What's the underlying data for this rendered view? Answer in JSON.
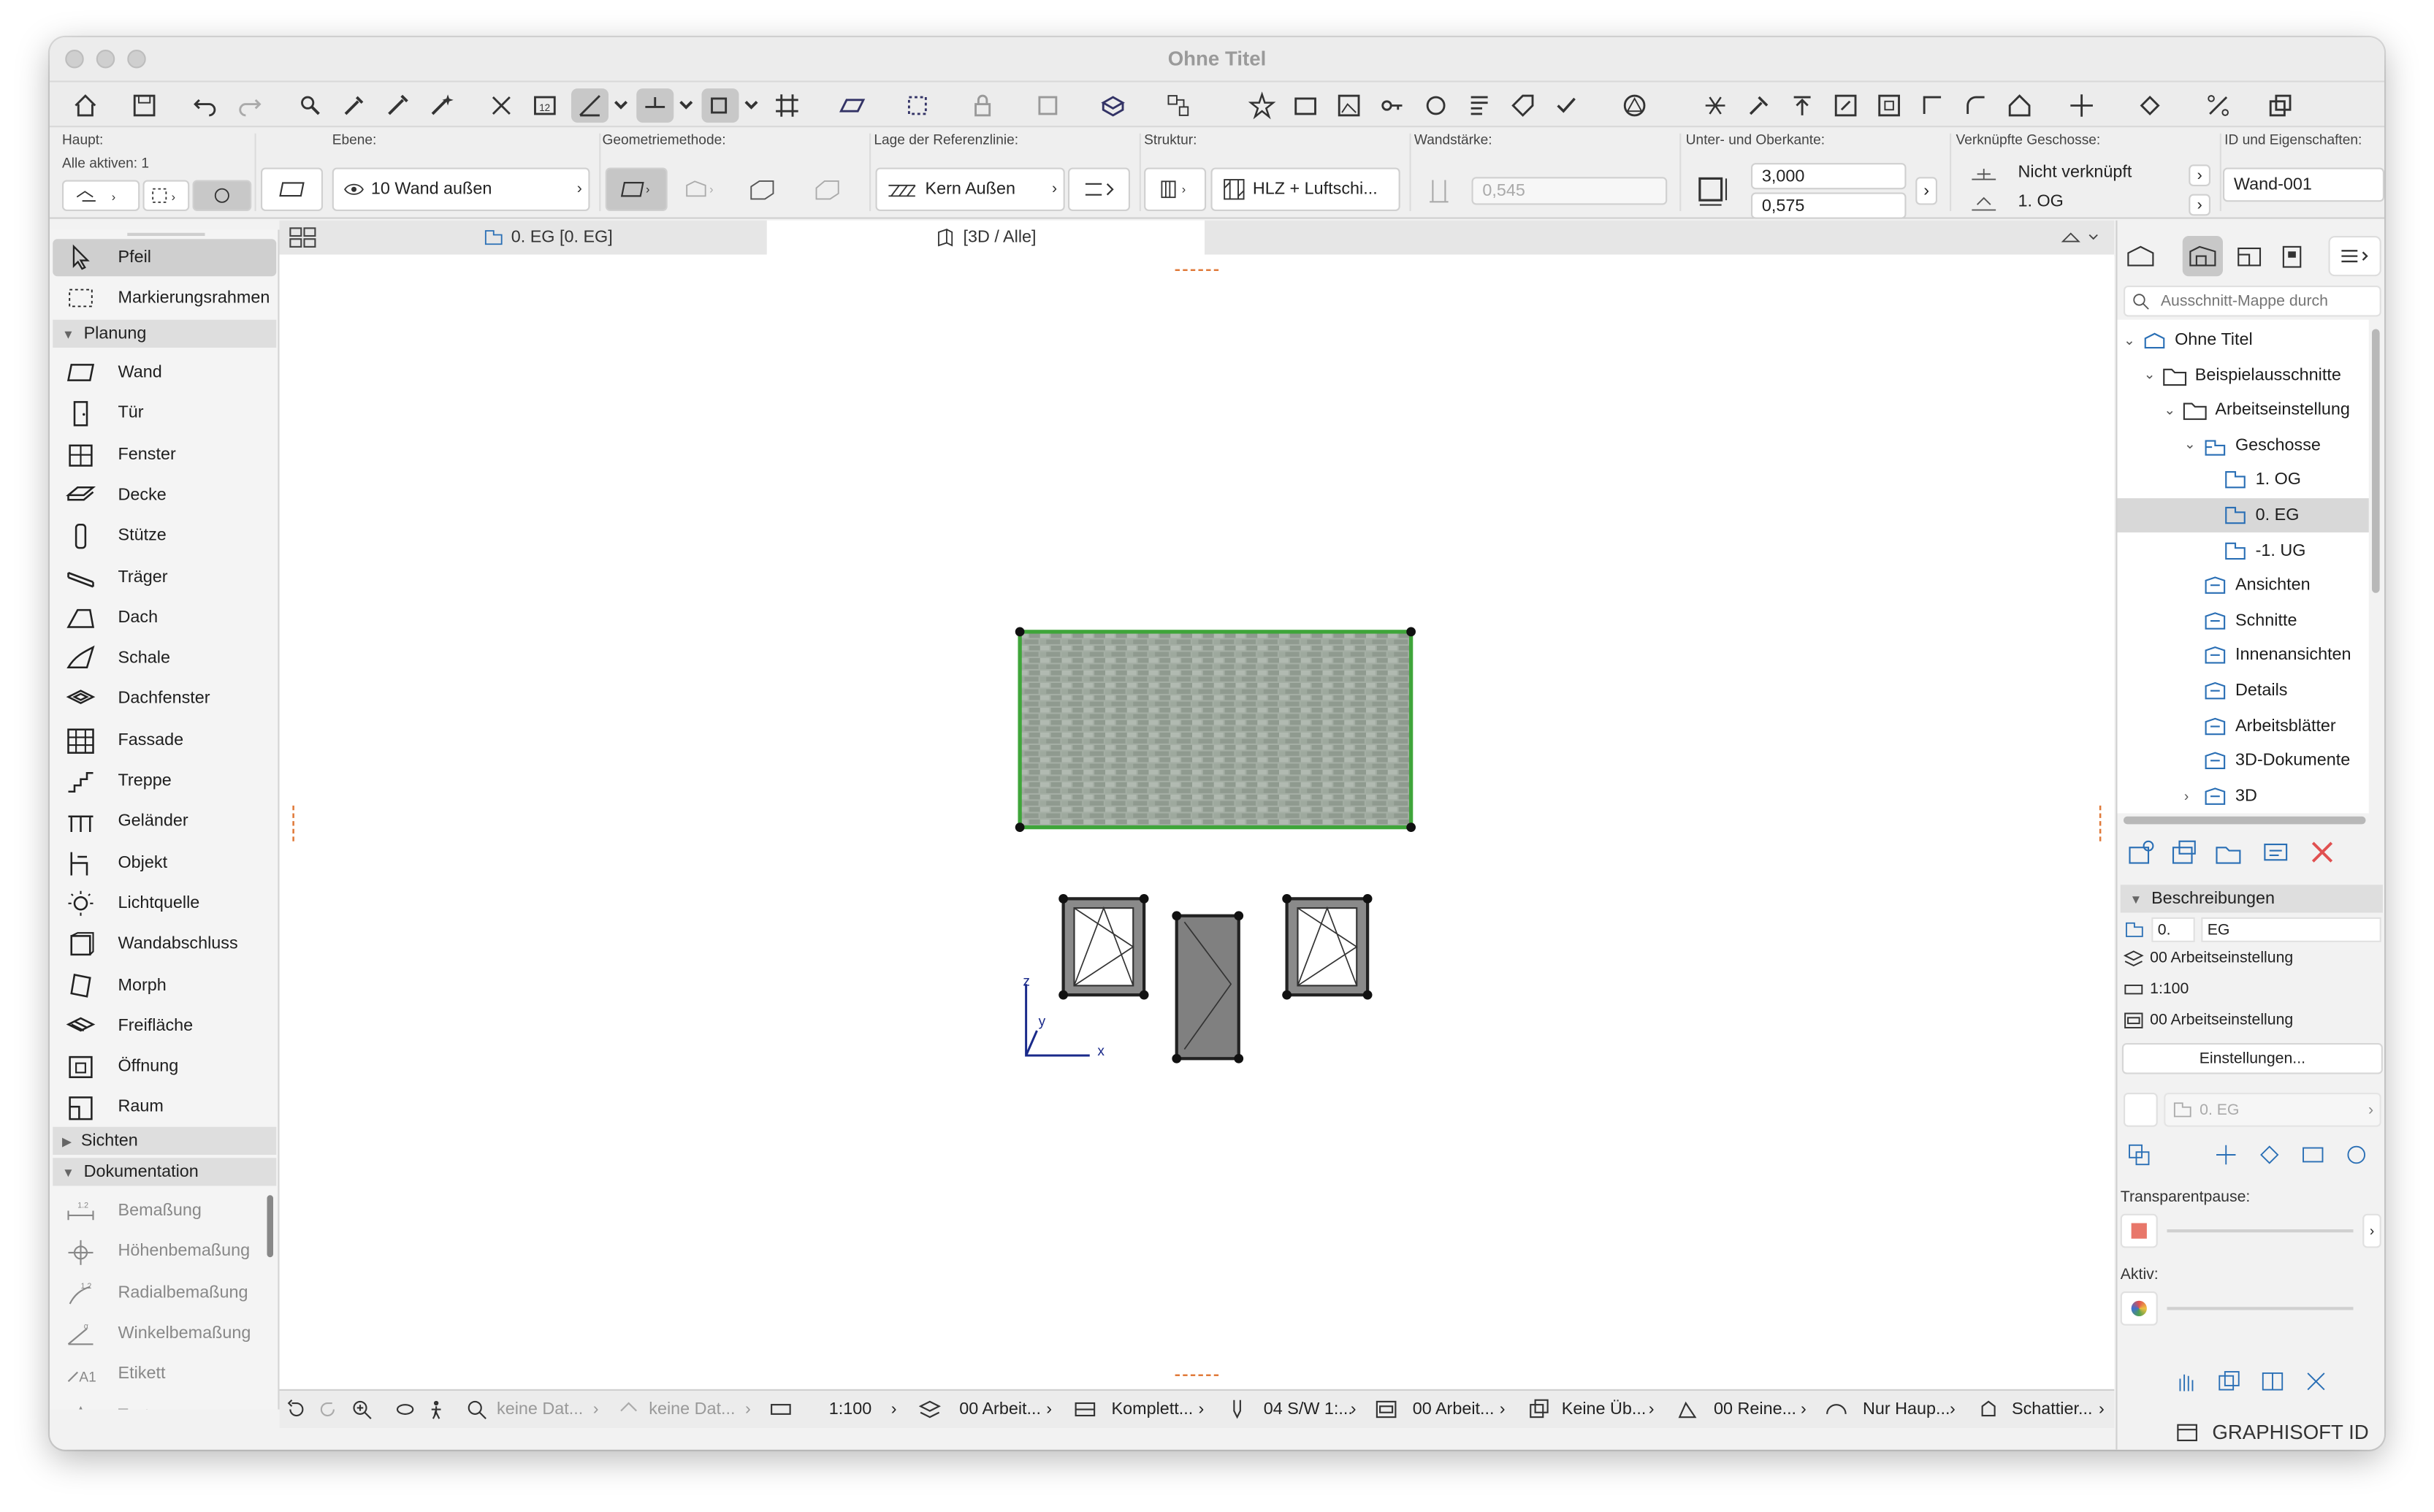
{
  "window": {
    "title": "Ohne Titel"
  },
  "info": {
    "haupt_label": "Haupt:",
    "alle_aktiven": "Alle aktiven: 1",
    "ebene_label": "Ebene:",
    "ebene_value": "10 Wand außen",
    "geometrie_label": "Geometriemethode:",
    "referenz_label": "Lage der Referenzlinie:",
    "referenz_value": "Kern Außen",
    "struktur_label": "Struktur:",
    "struktur_value": "HLZ + Luftschi...",
    "wandstaerke_label": "Wandstärke:",
    "wandstaerke_value": "0,545",
    "unter_ober_label": "Unter- und Oberkante:",
    "oberkante": "3,000",
    "unterkante": "0,575",
    "verknuepft_label": "Verknüpfte Geschosse:",
    "verknuepft_top": "Nicht verknüpft",
    "verknuepft_bottom": "1. OG",
    "id_label": "ID und Eigenschaften:",
    "id_value": "Wand-001"
  },
  "tools": {
    "pfeil": "Pfeil",
    "markierungsrahmen": "Markierungsrahmen",
    "planung": "Planung",
    "items": [
      "Wand",
      "Tür",
      "Fenster",
      "Decke",
      "Stütze",
      "Träger",
      "Dach",
      "Schale",
      "Dachfenster",
      "Fassade",
      "Treppe",
      "Geländer",
      "Objekt",
      "Lichtquelle",
      "Wandabschluss",
      "Morph",
      "Freifläche",
      "Öffnung",
      "Raum"
    ],
    "sichten": "Sichten",
    "dokumentation": "Dokumentation",
    "doc_items": [
      "Bemaßung",
      "Höhenbemaßung",
      "Radialbemaßung",
      "Winkelbemaßung",
      "Etikett",
      "Text"
    ]
  },
  "tabs": {
    "plan": "0. EG [0. EG]",
    "view3d": "[3D / Alle]"
  },
  "navigator": {
    "search_placeholder": "Ausschnitt-Mappe durch",
    "tree": [
      "Ohne Titel",
      "Beispielausschnitte",
      "Arbeitseinstellung",
      "Geschosse",
      "1. OG",
      "0. EG",
      "-1. UG",
      "Ansichten",
      "Schnitte",
      "Innenansichten",
      "Details",
      "Arbeitsblätter",
      "3D-Dokumente",
      "3D"
    ],
    "selected": "0. EG",
    "beschreibungen": "Beschreibungen",
    "geschoss_nr": "0.",
    "geschoss_name": "EG",
    "layer_combo": "00 Arbeitseinstellung",
    "scale": "1:100",
    "model_view": "00 Arbeitseinstellung",
    "einstellungen": "Einstellungen...",
    "storey_dim": "0. EG",
    "transparentpause": "Transparentpause:",
    "aktiv": "Aktiv:"
  },
  "status": {
    "keine1": "keine Dat...",
    "keine2": "keine Dat...",
    "scale": "1:100",
    "layer": "00 Arbeit...",
    "komplett": "Komplett...",
    "pen": "04 S/W 1:...",
    "model": "00 Arbeit...",
    "ueber": "Keine Üb...",
    "reno": "00 Reine...",
    "haupt": "Nur Haup...",
    "schatt": "Schattier..."
  },
  "brand": "GRAPHISOFT ID",
  "colors": {
    "wall_fill": "#9aa89a",
    "wall_outline": "#3fa53a"
  },
  "axes": {
    "x": "x",
    "y": "y",
    "z": "z"
  }
}
